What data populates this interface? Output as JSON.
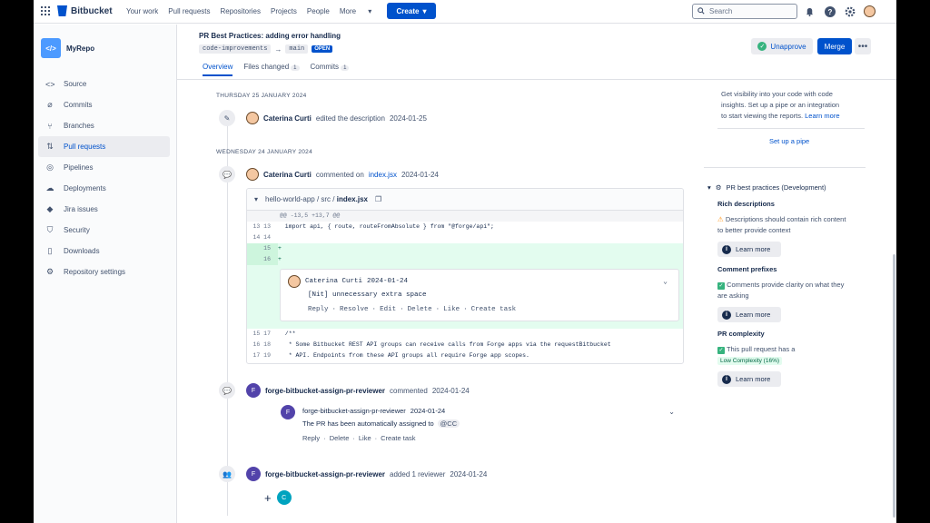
{
  "topnav": {
    "brand": "Bitbucket",
    "links": [
      "Your work",
      "Pull requests",
      "Repositories",
      "Projects",
      "People",
      "More"
    ],
    "create_label": "Create",
    "search_placeholder": "Search"
  },
  "sidebar": {
    "repo_name": "MyRepo",
    "items": [
      {
        "label": "Source",
        "icon": "code-icon"
      },
      {
        "label": "Commits",
        "icon": "commit-icon"
      },
      {
        "label": "Branches",
        "icon": "branch-icon"
      },
      {
        "label": "Pull requests",
        "icon": "pull-request-icon"
      },
      {
        "label": "Pipelines",
        "icon": "pipeline-icon"
      },
      {
        "label": "Deployments",
        "icon": "cloud-icon"
      },
      {
        "label": "Jira issues",
        "icon": "jira-icon"
      },
      {
        "label": "Security",
        "icon": "shield-icon"
      },
      {
        "label": "Downloads",
        "icon": "file-icon"
      },
      {
        "label": "Repository settings",
        "icon": "gear-icon"
      }
    ],
    "active_index": 3
  },
  "header": {
    "title": "PR Best Practices: adding error handling",
    "source_branch": "code-improvements",
    "target_branch": "main",
    "status": "OPEN",
    "tabs": [
      {
        "label": "Overview",
        "count": ""
      },
      {
        "label": "Files changed",
        "count": "1"
      },
      {
        "label": "Commits",
        "count": "1"
      }
    ],
    "unapprove_label": "Unapprove",
    "merge_label": "Merge"
  },
  "activity": {
    "day1": "THURSDAY 25 JANUARY 2024",
    "event1": {
      "author": "Caterina Curti",
      "action": "edited the description",
      "date": "2024-01-25"
    },
    "day2": "WEDNESDAY 24 JANUARY 2024",
    "event2": {
      "author": "Caterina Curti",
      "action": "commented on",
      "file": "index.jsx",
      "date": "2024-01-24"
    },
    "code": {
      "path_repo": "hello-world-app",
      "path_dir": "src",
      "path_file": "index.jsx",
      "hunk": "@@ -13,5 +13,7 @@",
      "lines_before": [
        {
          "n": "13 13",
          "text": "  import api, { route, routeFromAbsolute } from \"@forge/api\";"
        },
        {
          "n": "14 14",
          "text": ""
        },
        {
          "n": "   15",
          "text": "+",
          "add": true
        },
        {
          "n": "   16",
          "text": "+",
          "add": true
        }
      ],
      "lines_after": [
        {
          "n": "15 17",
          "text": "  /**"
        },
        {
          "n": "16 18",
          "text": "   * Some Bitbucket REST API groups can receive calls from Forge apps via the requestBitbucket"
        },
        {
          "n": "17 19",
          "text": "   * API. Endpoints from these API groups all require Forge app scopes."
        }
      ],
      "inline_comment": {
        "author": "Caterina Curti",
        "date": "2024-01-24",
        "text": "[Nit] unnecessary extra space",
        "actions": [
          "Reply",
          "Resolve",
          "Edit",
          "Delete",
          "Like",
          "Create task"
        ]
      }
    },
    "event3": {
      "author": "forge-bitbucket-assign-pr-reviewer",
      "action": "commented",
      "date": "2024-01-24"
    },
    "reply": {
      "author": "forge-bitbucket-assign-pr-reviewer",
      "date": "2024-01-24",
      "text": "The PR has been automatically assigned to",
      "mention": "@CC",
      "actions": [
        "Reply",
        "Delete",
        "Like",
        "Create task"
      ]
    },
    "event4": {
      "author": "forge-bitbucket-assign-pr-reviewer",
      "action": "added 1 reviewer",
      "date": "2024-01-24"
    },
    "reviewer_initial": "C",
    "bot_initial": "F"
  },
  "rightpanel": {
    "insights_text_1": "Get visibility into your code with code",
    "insights_text_2": "insights. Set up a pipe or an integration",
    "insights_text_3": "to start viewing the reports.",
    "learn_more_link": "Learn more",
    "setup_pipe": "Set up a pipe",
    "section_title": "PR best practices (Development)",
    "rich_title": "Rich descriptions",
    "rich_text_1": "Descriptions should contain rich content",
    "rich_text_2": "to better provide context",
    "learn_more": "Learn more",
    "prefix_title": "Comment prefixes",
    "prefix_text_1": "Comments provide clarity on what they",
    "prefix_text_2": "are asking",
    "complexity_title": "PR complexity",
    "complexity_text": "This pull request has a",
    "complexity_badge": "Low Complexity (16%)"
  }
}
